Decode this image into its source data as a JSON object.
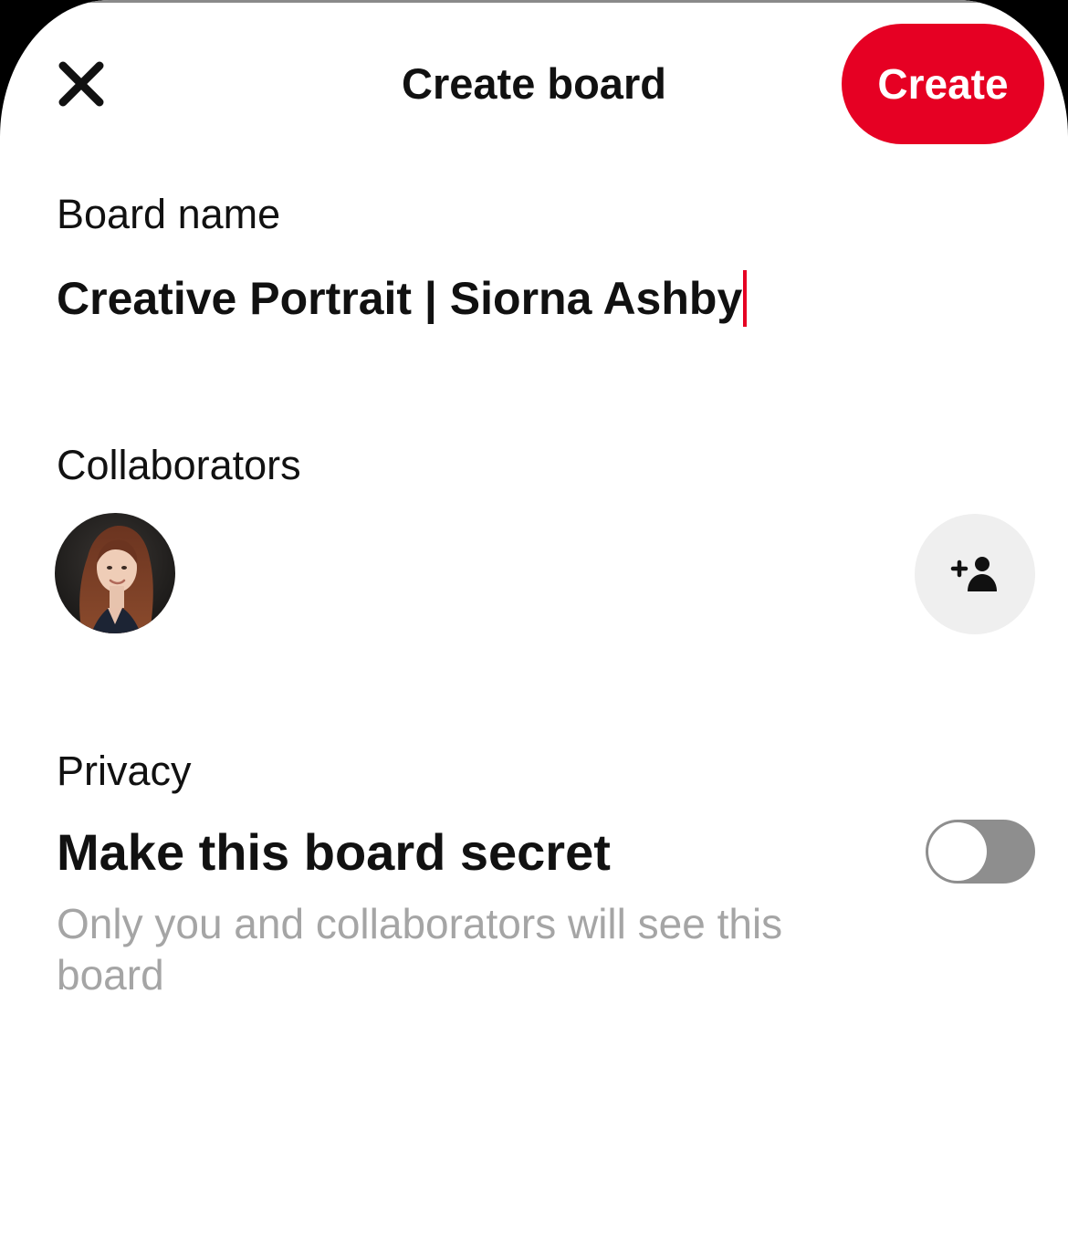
{
  "header": {
    "title": "Create board",
    "close_icon": "close-icon",
    "create_label": "Create",
    "accent_color": "#e60023"
  },
  "board_name": {
    "label": "Board name",
    "value": "Creative Portrait | Siorna Ashby"
  },
  "collaborators": {
    "label": "Collaborators",
    "avatar_icon": "avatar",
    "add_icon": "add-person-icon"
  },
  "privacy": {
    "label": "Privacy",
    "secret_title": "Make this board secret",
    "secret_description": "Only you and collaborators will see this board",
    "secret_enabled": false
  }
}
